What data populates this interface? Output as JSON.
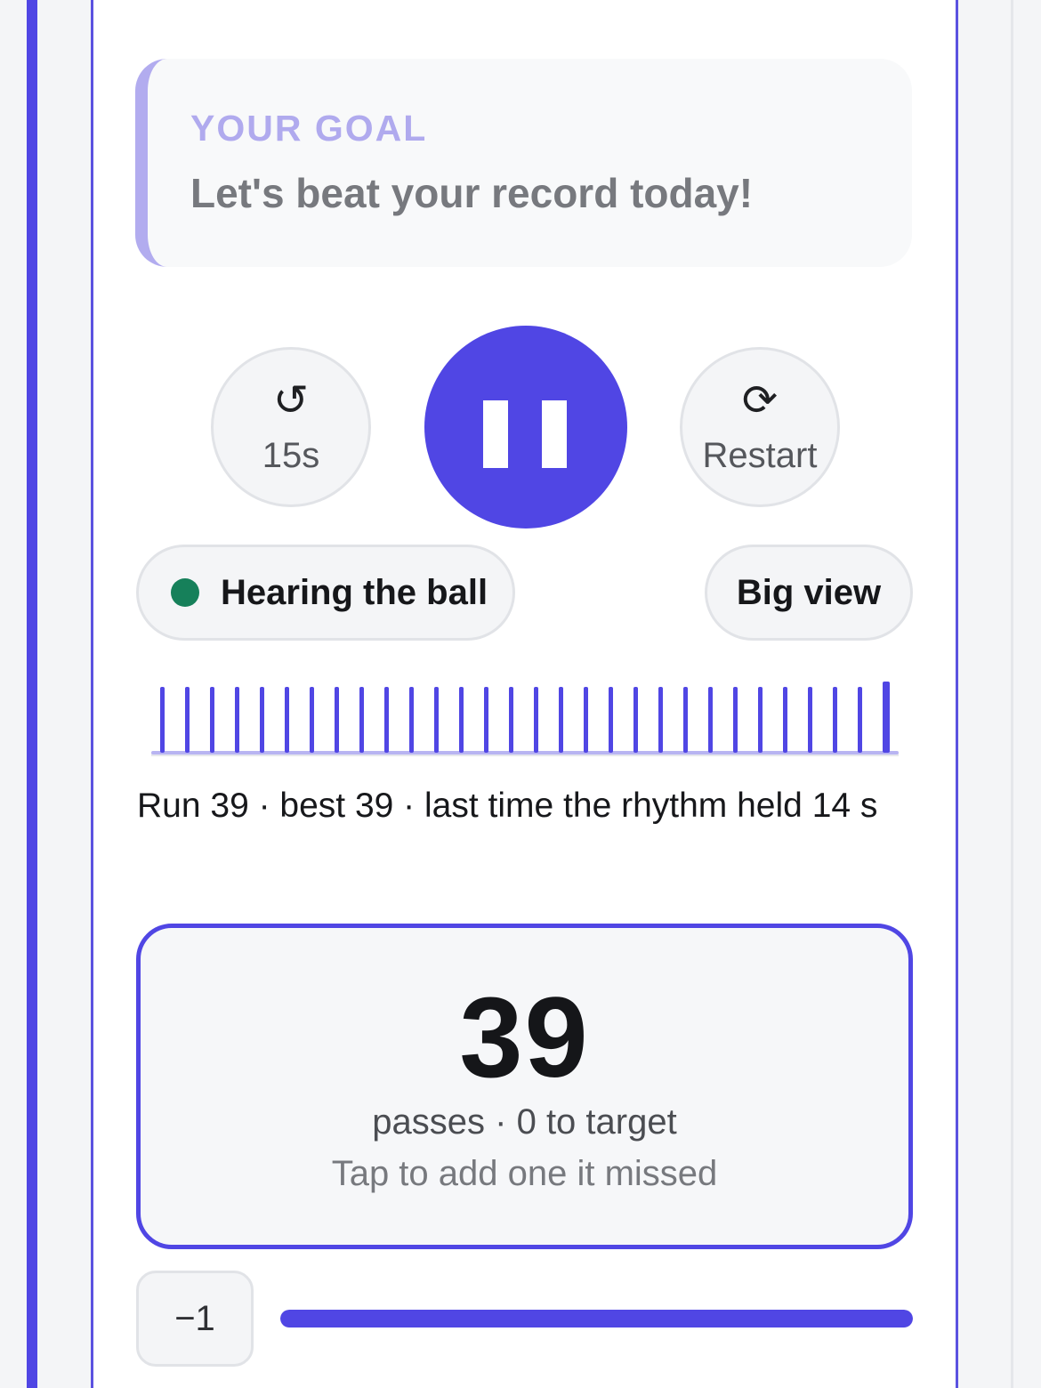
{
  "goal": {
    "label": "YOUR GOAL",
    "text": "Let's beat your record today!"
  },
  "controls": {
    "rewind": {
      "icon": "rewind-icon",
      "glyph": "↺",
      "label": "15s"
    },
    "pause": {
      "icon": "pause-icon"
    },
    "restart": {
      "icon": "restart-icon",
      "glyph": "⟳",
      "label": "Restart"
    }
  },
  "status": {
    "label": "Hearing the ball",
    "dot_color": "#16805a"
  },
  "big_view": {
    "label": "Big view"
  },
  "ticks": {
    "count": 30
  },
  "run_line": "Run 39 · best 39 · last time the rhythm held 14 s",
  "counter": {
    "value": "39",
    "subtitle": "passes · 0 to target",
    "hint": "Tap to add one it missed"
  },
  "decrement": {
    "label": "−1"
  },
  "progress": {
    "fraction": 1.0
  },
  "colors": {
    "accent": "#5046e4",
    "goal_accent": "#b2acef"
  }
}
